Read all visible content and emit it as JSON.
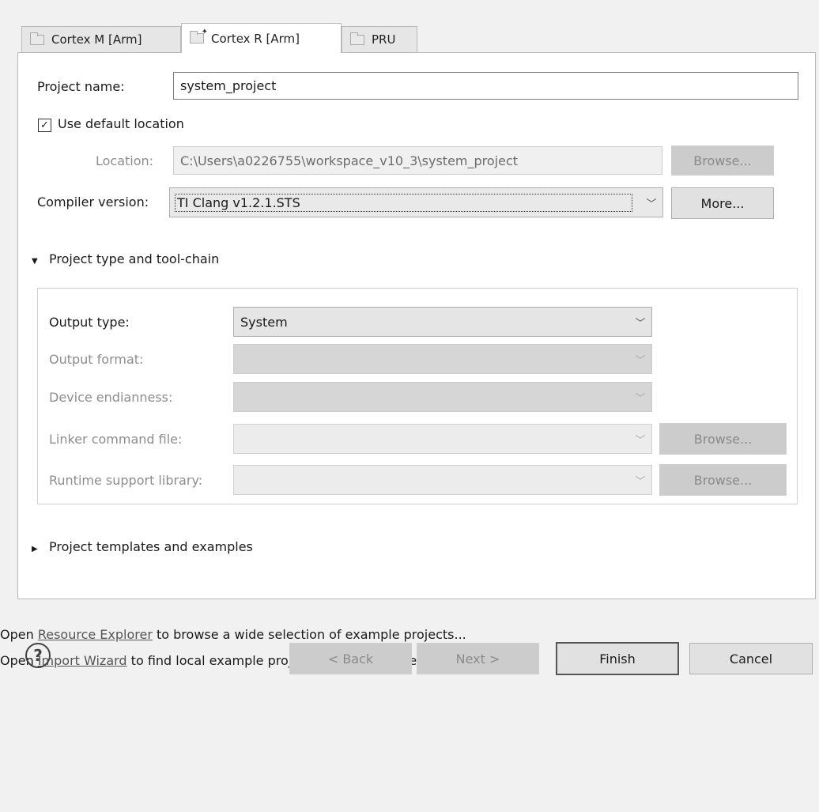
{
  "tabs": [
    {
      "label": "Cortex M [Arm]",
      "active": false,
      "icon": "folder-icon"
    },
    {
      "label": "Cortex R [Arm]",
      "active": true,
      "icon": "folder-new-icon"
    },
    {
      "label": "PRU",
      "active": false,
      "icon": "folder-icon"
    }
  ],
  "form": {
    "project_name_label": "Project name:",
    "project_name_value": "system_project",
    "use_default_location_label": "Use default location",
    "use_default_location_checked": true,
    "location_label": "Location:",
    "location_value": "C:\\Users\\a0226755\\workspace_v10_3\\system_project",
    "location_browse": "Browse...",
    "compiler_label": "Compiler version:",
    "compiler_value": "TI Clang v1.2.1.STS",
    "more_button": "More..."
  },
  "toolchain": {
    "header": "Project type and tool-chain",
    "expanded": true,
    "output_type_label": "Output type:",
    "output_type_value": "System",
    "output_format_label": "Output format:",
    "device_endianness_label": "Device endianness:",
    "linker_label": "Linker command file:",
    "linker_browse": "Browse...",
    "runtime_label": "Runtime support library:",
    "runtime_browse": "Browse..."
  },
  "templates": {
    "header": "Project templates and examples",
    "expanded": false
  },
  "info": {
    "line1_prefix": "Open ",
    "line1_link": "Resource Explorer",
    "line1_suffix": " to browse a wide selection of example projects...",
    "line2_prefix": "Open ",
    "line2_link": "Import Wizard",
    "line2_suffix": " to find local example projects for selected device..."
  },
  "footer": {
    "help": "?",
    "back": "< Back",
    "next": "Next >",
    "finish": "Finish",
    "cancel": "Cancel"
  }
}
